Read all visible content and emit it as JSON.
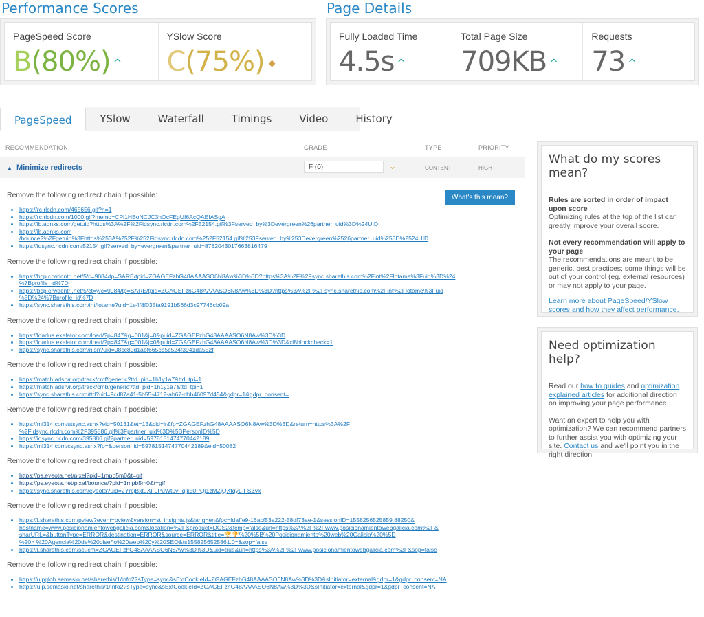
{
  "performance": {
    "title": "Performance Scores",
    "pagespeed": {
      "label": "PageSpeed Score",
      "grade": "B",
      "pct": "(80%)"
    },
    "yslow": {
      "label": "YSlow Score",
      "grade": "C",
      "pct": "(75%)"
    }
  },
  "details": {
    "title": "Page Details",
    "loaded": {
      "label": "Fully Loaded Time",
      "value": "4.5s"
    },
    "size": {
      "label": "Total Page Size",
      "value": "709KB"
    },
    "requests": {
      "label": "Requests",
      "value": "73"
    }
  },
  "tabs": [
    "PageSpeed",
    "YSlow",
    "Waterfall",
    "Timings",
    "Video",
    "History"
  ],
  "table": {
    "headers": {
      "recommendation": "RECOMMENDATION",
      "grade": "GRADE",
      "type": "TYPE",
      "priority": "PRIORITY"
    },
    "row": {
      "name": "Minimize redirects",
      "grade": "F (0)",
      "type": "CONTENT",
      "priority": "HIGH"
    }
  },
  "whats_this": "What's this mean?",
  "groups": [
    {
      "head": "Remove the following redirect chain if possible:",
      "links": [
        "https://rc.rlcdn.com/465656.gif?n=1",
        "https://rc.rlcdn.com/1000.gif?memo=CPi1HBoNCJC3hOcFEgUI6AcQAEIASgA",
        "https://ib.adnxs.com/getuid?https%3A%2F%2Fidsync.rlcdn.com%2F52154.gif%3Fserved_by%3Devergreen%26partner_uid%3D%24UID",
        "https://ib.adnxs.com\n/bounce?%2Fgetuid%3Fhttps%253A%252F%252Fidsync.rlcdn.com%252F52154.gif%253Fserved_by%253Devergreen%2526partner_uid%253D%2524UID",
        "https://idsync.rlcdn.com/52154.gif?served_by=evergreen&partner_uid=8782043017663816479"
      ]
    },
    {
      "head": "Remove the following redirect chain if possible:",
      "links": [
        "https://bcp.crwdcntrl.net/5/c=9084/tp=SARE/tpid=ZGAGEFzhG48AAAASO6N8Aw%3D%3D?https%3A%2F%2Fsync.sharethis.com%2Fint%2Flotame%3Fuid%3D%24\n%7Bprofile_id%7D",
        "https://bcp.crwdcntrl.net/5/ct=y/c=9084/tp=SARE/tpid=ZGAGEFzhG48AAAASO6N8Aw%3D%3D?https%3A%2F%2Fsync.sharethis.com%2Fint%2Flotame%3Fuid\n%3D%24%7Bprofile_id%7D",
        "https://sync.sharethis.com/int/lotame?uid=1e4f8f035fa9191b566d3c97746cb09a"
      ]
    },
    {
      "head": "Remove the following redirect chain if possible:",
      "links": [
        "https://loadus.exelator.com/load/?p=847&g=001&j=0&puid=ZGAGEFzhG48AAAASO6N8Aw%3D%3D",
        "https://loadus.exelator.com/load/?p=847&g=001&j=0&puid=ZGAGEFzhG48AAAASO6N8Aw%3D%3D&xl8blockcheck=1",
        "https://sync.sharethis.com/nlsn?uid=08cc80d1abf665cb5c524f3941da552f"
      ]
    },
    {
      "head": "Remove the following redirect chain if possible:",
      "links": [
        "https://match.adsrvr.org/track/cmf/generic?ttd_pid=1h1y1a7&ttd_tpi=1",
        "https://match.adsrvr.org/track/cmb/generic?ttd_pid=1h1y1a7&ttd_tpi=1",
        "https://sync.sharethis.com/ttd?uid=9cd87a41-5b55-4712-ab67-dbb46097d454&gdpr=1&gdpr_consent="
      ]
    },
    {
      "head": "Remove the following redirect chain if possible:",
      "links": [
        "https://ml314.com/utsync.ashx?eid=50131&et=13&cid=lr&fp=ZGAGEFzhG48AAAASO6N8Aw%3D%3D&return=https%3A%2F\n%2Fidsync.rlcdn.com%2F395886.gif%3Fpartner_uid%3D%5BPersonID%5D",
        "https://idsync.rlcdn.com/395886.gif?partner_uid=5978151474770442189",
        "https://ml314.com/csync.ashx?fp=&person_id=5978151474770442189&eid=50082"
      ]
    },
    {
      "head": "Remove the following redirect chain if possible:",
      "dark": [
        0,
        1
      ],
      "links": [
        "https://ps.eyeota.net/pixel?pid=1mpb5m0&t=gif",
        "https://ps.eyeota.net/pixel/bounce/?pid=1mpb5m0&t=gif",
        "https://sync.sharethis.com/eyeota?uid=2YrcjBxtuXFLPuWtuvFqjk50PQj1zMZjQXfqyL-FSZvk"
      ]
    },
    {
      "head": "Remove the following redirect chain if possible:",
      "links": [
        "https://l.sharethis.com/pview?event=pview&version=st_insights.js&lang=en&fpc=fdaffe9-16acf53a222-58df73ae-1&sessionID=1558256525859.88250&\nhostname=www.posicionamientowebgalicia.com&location=%2F&product=DOS2&fcmp=false&url=https%3A%2F%2Fwww.posicionamientowebgalicia.com%2F&\nsharURL=&buttonType=ERROR&destination=ERROR&source=ERROR&title=🏆🏆%20%5B%20Posicionamiento%20web%20Galicia%20%5D\n%20> %20Agencia%20de%20diseño%20web%20y%20SEO&ts1558256525861.0=&sop=false",
        "https://l.sharethis.com/sc?cm=ZGAGEFzhG48AAAASO6N8Aw%3D%3D&uid=true&url=https%3A%2F%2Fwww.posicionamientowebgalicia.com%2F&sop=false"
      ]
    },
    {
      "head": "Remove the following redirect chain if possible:",
      "links": [
        "https://uipglob.semasio.net/sharethis/1/info2?sType=sync&sExtCookieId=ZGAGEFzhG48AAAASO6N8Aw%3D%3D&sInitiator=external&gdpr=1&gdpr_consent=NA",
        "https://uip.semasio.net/sharethis/1/info2?sType=sync&sExtCookieId=ZGAGEFzhG48AAAASO6N8Aw%3D%3D&sInitiator=external&gdpr=1&gdpr_consent=NA"
      ]
    }
  ],
  "side1": {
    "title": "What do my scores mean?",
    "b1": "Rules are sorted in order of impact upon score",
    "t1": "Optimizing rules at the top of the list can greatly improve your overall score.",
    "b2": "Not every recommendation will apply to your page",
    "t2": "The recommendations are meant to be generic, best practices; some things will be out of your control (eg. external resources) or may not apply to your page.",
    "link": "Learn more about PageSpeed/YSlow scores and how they affect performance."
  },
  "side2": {
    "title": "Need optimization help?",
    "p1a": "Read our ",
    "l1": "how to guides",
    "p1b": " and ",
    "l2": "optimization explained articles",
    "p1c": " for additional direction on improving your page performance.",
    "p2a": "Want an expert to help you with optimization? We can recommend partners to further assist you with optimizing your site. ",
    "l3": "Contact us",
    "p2b": " and we'll point you in the right direction."
  }
}
